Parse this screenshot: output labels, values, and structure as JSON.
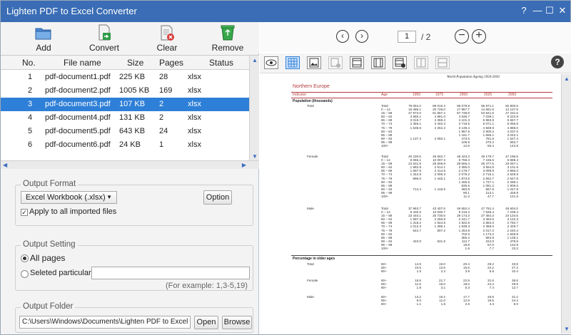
{
  "window": {
    "title": "Lighten PDF to Excel Converter",
    "help": "?",
    "minimize": "—",
    "maximize": "☐",
    "close": "✕"
  },
  "toolbar": {
    "add": "Add",
    "convert": "Convert",
    "clear": "Clear",
    "remove": "Remove"
  },
  "table": {
    "headers": {
      "no": "No.",
      "file": "File name",
      "size": "Size",
      "pages": "Pages",
      "status": "Status"
    },
    "rows": [
      {
        "no": "1",
        "file": "pdf-document1.pdf",
        "size": "225 KB",
        "pages": "28",
        "status": "xlsx"
      },
      {
        "no": "2",
        "file": "pdf-document2.pdf",
        "size": "1005 KB",
        "pages": "169",
        "status": "xlsx"
      },
      {
        "no": "3",
        "file": "pdf-document3.pdf",
        "size": "107 KB",
        "pages": "2",
        "status": "xlsx"
      },
      {
        "no": "4",
        "file": "pdf-document4.pdf",
        "size": "131 KB",
        "pages": "2",
        "status": "xlsx"
      },
      {
        "no": "5",
        "file": "pdf-document5.pdf",
        "size": "643 KB",
        "pages": "24",
        "status": "xlsx"
      },
      {
        "no": "6",
        "file": "pdf-document6.pdf",
        "size": "24 KB",
        "pages": "1",
        "status": "xlsx"
      }
    ],
    "selected_row": 3
  },
  "output_format": {
    "title": "Output Format",
    "format_value": "Excel Workbook (.xlsx)",
    "option_button": "Option",
    "apply_all_label": "Apply to all imported files",
    "apply_all_checked": true
  },
  "output_setting": {
    "title": "Output Setting",
    "all_pages_label": "All pages",
    "selected_pages_label": "Seleted particular pages",
    "selected_pages_value": "",
    "example_hint": "(For example: 1,3-5,19)",
    "mode": "all"
  },
  "output_folder": {
    "title": "Output Folder",
    "path": "C:\\Users\\Windows\\Documents\\Lighten PDF to Excel Converter",
    "open_button": "Open",
    "browse_button": "Browse"
  },
  "viewer": {
    "current_page": "1",
    "total_pages": "/ 2",
    "prev_icon": "chevron-left-icon",
    "next_icon": "chevron-right-icon",
    "zoom_out_icon": "minus-icon",
    "zoom_in_icon": "plus-icon"
  },
  "doc": {
    "header": "World Population Ageing 1950-2050",
    "region": "Northern Europe",
    "columns": [
      "Indicator",
      "Age",
      "1950",
      "1975",
      "2000",
      "2025",
      "2050"
    ],
    "section1": "Population (thousands)",
    "section2": "Percentage in older ages",
    "groups": [
      "Total",
      "Female",
      "Male"
    ],
    "ages": "Total\n0 – 14\n15 – 59\n60 – 64\n65 – 69\n70 – 74\n75 – 79\n80 – 84\n85 – 89\n90 – 94\n95 – 99\n100+",
    "total_cols": [
      "78 094.2\n18 495.1\n47 972.0\n3 580.1\n3 015.7\n2 355.1\n1 538.6\n\n\n1 137.4\n\n",
      "89 010.3\n20 728.0\n51 557.4\n4 881.0\n4 359.4\n3 402.3\n2 252.2\n\n\n2 050.1\n\n",
      "95 079.9\n17 987.7\n57 738.8\n4 636.7\n4 101.3\n3 718.5\n3 138.4\n1 967.5\n1 191.7\n473.6\n108.8\n12.9",
      "96 971.1\n14 691.9\n53 941.8\n7 039.1\n5 983.9\n5 071.1\n4 569.9\n2 900.2\n1 666.1\n781.6\n270.2\n55.4",
      "92 800.6\n14 107.8\n47 231.6\n6 223.9\n5 657.7\n5 056.6\n4 888.0\n4 037.0\n3 042.1\n1 527.4\n563.7\n144.8"
    ],
    "female_cols": [
      "40 230.5\n9 065.1\n24 531.9\n1 982.8\n1 697.5\n1 342.8\n896.0\n\n\n714.4\n\n",
      "45 602.7\n10 097.3\n25 606.9\n2 614.1\n2 414.6\n2 006.3\n1 445.1\n\n\n1 418.5\n\n",
      "48 423.3\n8 768.3\n28 565.4\n2 395.0\n2 178.7\n2 079.2\n1 873.5\n1 265.5\n835.5\n360.9\n90.1\n11.3",
      "49 179.7\n7 155.5\n26 477.5\n3 554.5\n3 099.9\n2 715.1\n2 552.7\n1 727.1\n1 081.2\n557.6\n213.1\n47.7",
      "47 196.6\n6 868.4\n23 097.1\n3 101.6\n2 865.0\n2 626.9\n2 647.6\n2 288.1\n1 905.0\n1 047.9\n428.8\n121.5"
    ],
    "male_cols": [
      "37 863.7\n9 430.0\n23 440.1\n1 597.3\n1 318.2\n1 012.3\n642.7\n\n\n423.0\n\n",
      "43 407.6\n10 630.7\n25 730.5\n2 266.8\n1 944.8\n1 396.1\n807.2\n\n\n631.5\n\n",
      "46 652.4\n9 219.3\n29 173.3\n2 241.7\n1 922.6\n1 639.3\n1 264.8\n702.0\n356.2\n112.7\n18.8\n1.6",
      "47 791.4\n7 536.4\n27 464.3\n3 484.6\n2 884.0\n2 358.0\n2 017.2\n1 173.2\n584.9\n224.0\n57.0\n7.7",
      "45 604.0\n7 239.4\n24 134.5\n3 122.3\n2 792.7\n2 429.7\n2 240.4\n1 848.9\n1 139.1\n479.5\n134.9\n23.3"
    ],
    "pct_ages": "60+\n65+\n80+",
    "pct_total": [
      "14.9\n10.5\n1.5",
      "19.0\n13.6\n2.2",
      "20.4\n15.5\n3.9",
      "29.2\n22.2\n5.9",
      "33.9\n27.2\n10.4"
    ],
    "pct_female": [
      "16.5\n11.6\n1.8",
      "21.7\n16.0\n3.1",
      "22.9\n18.0\n5.3",
      "31.6\n24.4\n7.4",
      "36.5\n29.9\n12.7"
    ],
    "pct_male": [
      "13.2\n9.0\n1.1",
      "16.2\n11.0\n1.5",
      "17.7\n12.9\n2.6",
      "26.8\n19.5\n4.3",
      "31.2\n24.4\n8.0"
    ]
  }
}
